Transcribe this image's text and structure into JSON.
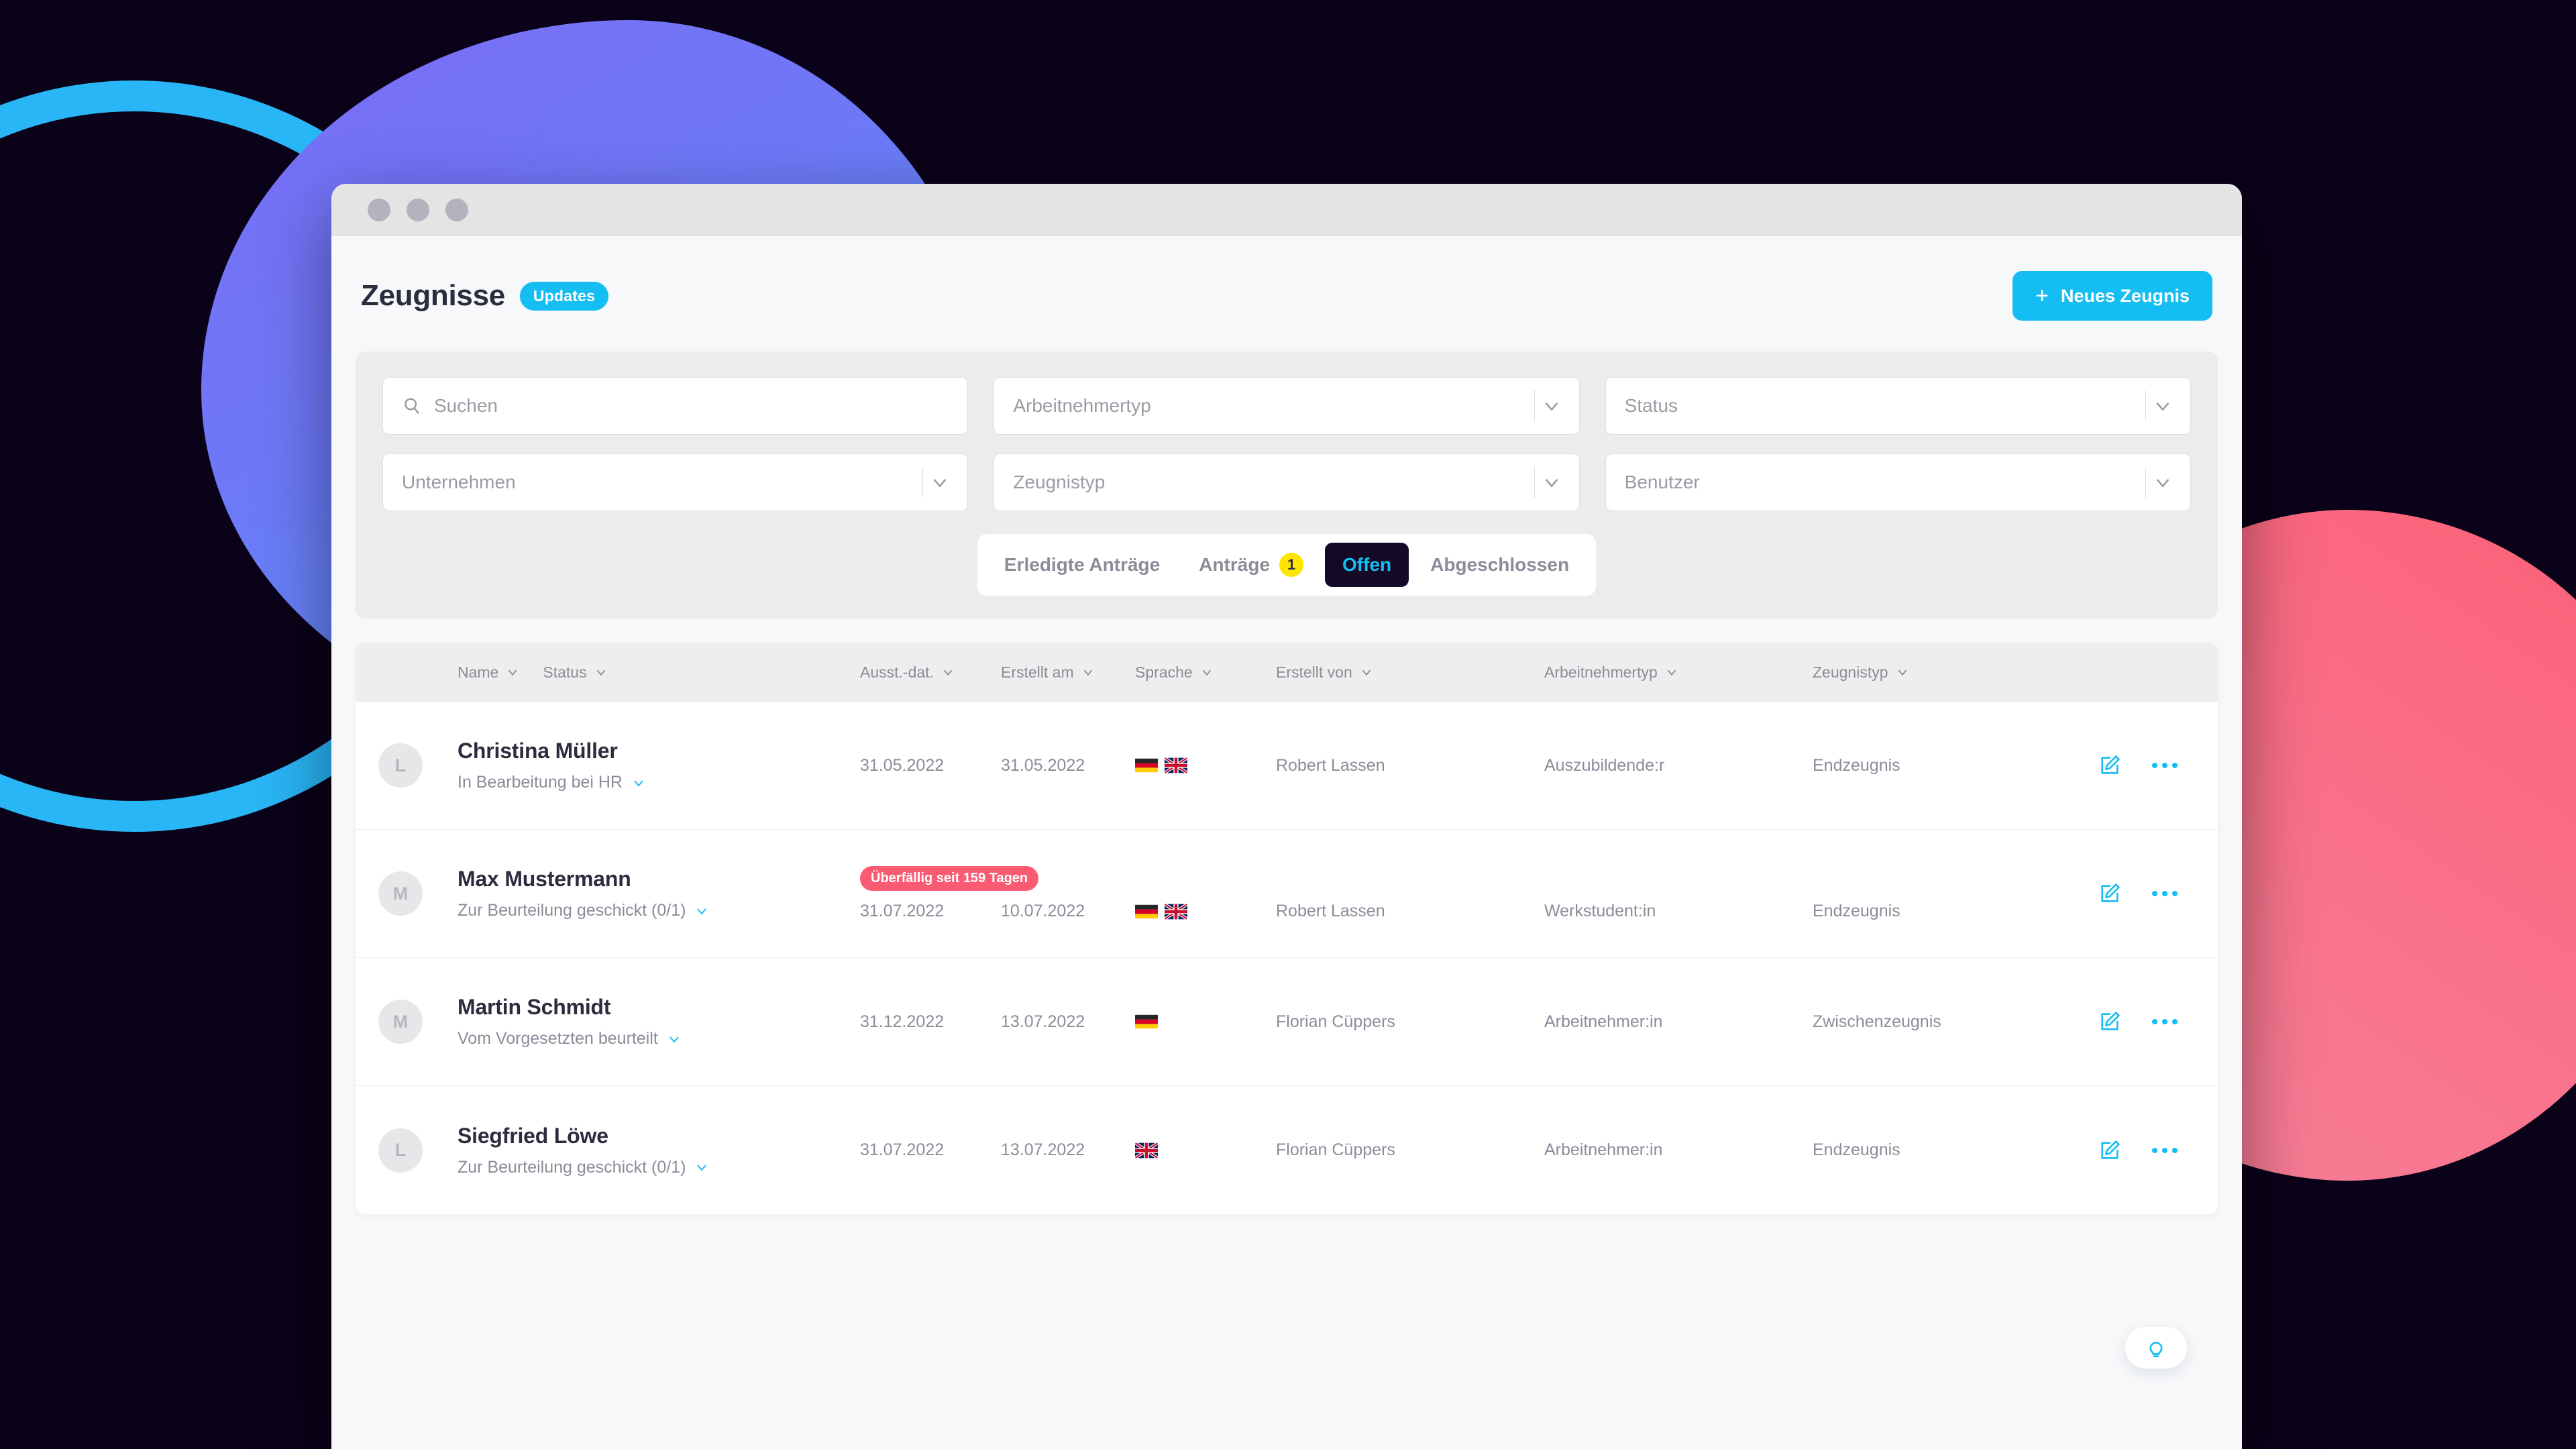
{
  "theme": {
    "accent": "#14bdf2",
    "background": "#0a0218",
    "tab_active_bg": "#140a28",
    "count_badge": "#ffe500",
    "overdue_badge": "#fb5a73",
    "blob_blue": "#6d79f7",
    "blob_pink": "#fc6077",
    "ring_cyan": "#29b6f6"
  },
  "header": {
    "title": "Zeugnisse",
    "badge": "Updates",
    "primary_button": "Neues Zeugnis",
    "primary_button_icon": "plus-icon"
  },
  "filters": {
    "search": {
      "placeholder": "Suchen",
      "value": "",
      "icon": "search-icon"
    },
    "fields": [
      {
        "name": "arbeitnehmertyp",
        "placeholder": "Arbeitnehmertyp",
        "value": ""
      },
      {
        "name": "status",
        "placeholder": "Status",
        "value": ""
      },
      {
        "name": "unternehmen",
        "placeholder": "Unternehmen",
        "value": ""
      },
      {
        "name": "zeugnistyp",
        "placeholder": "Zeugnistyp",
        "value": ""
      },
      {
        "name": "benutzer",
        "placeholder": "Benutzer",
        "value": ""
      }
    ]
  },
  "tabs": [
    {
      "label": "Erledigte Anträge",
      "count": null,
      "active": false
    },
    {
      "label": "Anträge",
      "count": "1",
      "active": false
    },
    {
      "label": "Offen",
      "count": null,
      "active": true
    },
    {
      "label": "Abgeschlossen",
      "count": null,
      "active": false
    }
  ],
  "table": {
    "columns": [
      {
        "label": "Name"
      },
      {
        "label": "Status"
      },
      {
        "label": "Ausst.-dat."
      },
      {
        "label": "Erstellt am"
      },
      {
        "label": "Sprache"
      },
      {
        "label": "Erstellt von"
      },
      {
        "label": "Arbeitnehmertyp"
      },
      {
        "label": "Zeugnistyp"
      }
    ],
    "rows": [
      {
        "avatar": "L",
        "name": "Christina Müller",
        "status": "In Bearbeitung bei HR",
        "overdue": "",
        "ausstellungsdatum": "31.05.2022",
        "erstellt_am": "31.05.2022",
        "sprachen": [
          "de",
          "gb"
        ],
        "erstellt_von": "Robert Lassen",
        "arbeitnehmertyp": "Auszubildende:r",
        "zeugnistyp": "Endzeugnis"
      },
      {
        "avatar": "M",
        "name": "Max Mustermann",
        "status": "Zur Beurteilung geschickt (0/1)",
        "overdue": "Überfällig seit 159 Tagen",
        "ausstellungsdatum": "31.07.2022",
        "erstellt_am": "10.07.2022",
        "sprachen": [
          "de",
          "gb"
        ],
        "erstellt_von": "Robert Lassen",
        "arbeitnehmertyp": "Werkstudent:in",
        "zeugnistyp": "Endzeugnis"
      },
      {
        "avatar": "M",
        "name": "Martin Schmidt",
        "status": "Vom Vorgesetzten beurteilt",
        "overdue": "",
        "ausstellungsdatum": "31.12.2022",
        "erstellt_am": "13.07.2022",
        "sprachen": [
          "de"
        ],
        "erstellt_von": "Florian Cüppers",
        "arbeitnehmertyp": "Arbeitnehmer:in",
        "zeugnistyp": "Zwischenzeugnis"
      },
      {
        "avatar": "L",
        "name": "Siegfried Löwe",
        "status": "Zur Beurteilung geschickt (0/1)",
        "overdue": "",
        "ausstellungsdatum": "31.07.2022",
        "erstellt_am": "13.07.2022",
        "sprachen": [
          "gb"
        ],
        "erstellt_von": "Florian Cüppers",
        "arbeitnehmertyp": "Arbeitnehmer:in",
        "zeugnistyp": "Endzeugnis"
      }
    ],
    "row_actions": {
      "edit_icon": "edit-icon",
      "more_icon": "more-options-icon"
    }
  },
  "help_fab": {
    "icon": "lightbulb-icon"
  }
}
